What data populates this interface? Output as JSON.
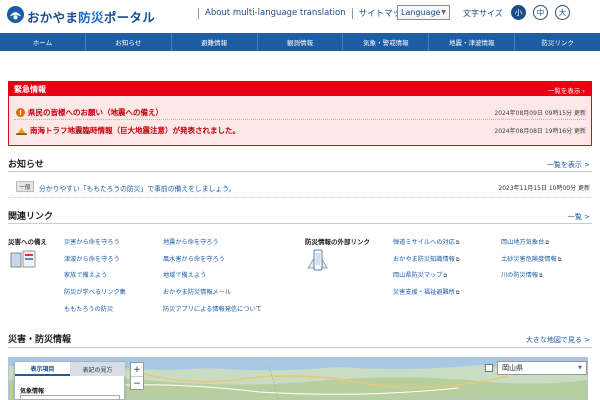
{
  "header": {
    "brand_prefix": "おかやま",
    "brand_highlight": "防災",
    "brand_suffix": "ポータル",
    "link_multilang": "About multi-language translation",
    "link_sitemap": "サイトマップ",
    "language_select": "Language",
    "font_size_label": "文字サイズ",
    "font_small": "小",
    "font_medium": "中",
    "font_large": "大"
  },
  "nav": [
    "ホーム",
    "お知らせ",
    "避難情報",
    "観測情報",
    "気象・警戒情報",
    "地震・津波情報",
    "防災リンク"
  ],
  "emergency": {
    "title": "緊急情報",
    "more": "一覧を表示 ›",
    "items": [
      {
        "text": "県民の皆様へのお願い（地震への備え）",
        "date": "2024年08月09日 09時15分 更新",
        "icon": "warning-icon"
      },
      {
        "text": "南海トラフ地震臨時情報（巨大地震注意）が発表されました。",
        "date": "2024年08月08日 19時16分 更新",
        "icon": "earthquake-icon"
      }
    ]
  },
  "notices": {
    "title": "お知らせ",
    "more": "一覧を表示 >",
    "items": [
      {
        "tag": "一般",
        "text": "分かりやすい「ももたろうの防災」で事前の備えをしましょう。",
        "date": "2023年11月15日 10時00分 更新"
      }
    ]
  },
  "links": {
    "title": "関連リンク",
    "more": "一覧 >",
    "block1_label": "災害への備え",
    "col1": [
      "災害から命を守ろう",
      "津波から命を守ろう",
      "家族で備えよう",
      "防災が学べるリンク集",
      "ももたろうの防災"
    ],
    "col2": [
      "地震から命を守ろう",
      "風水害から命を守ろう",
      "地域で備えよう",
      "おかやま防災情報メール",
      "防災アプリによる情報発信について"
    ],
    "block2_label": "防災情報の外部リンク",
    "col3": [
      "弾道ミサイルへの対応",
      "おかやま防災知識情報",
      "岡山県防災マップ",
      "災害支援・福祉避難所"
    ],
    "col4": [
      "岡山地方気象台",
      "土砂災害危険度情報",
      "川の防災情報"
    ]
  },
  "disaster": {
    "title": "災害・防災情報",
    "more": "大きな地図で見る >",
    "tab_display": "表示項目",
    "tab_legend": "表記の見方",
    "panel_label": "気象情報",
    "zoom_in": "+",
    "zoom_out": "−",
    "prefecture": "岡山県"
  },
  "colors": {
    "primary": "#1d5da3",
    "alert_red": "#e60012",
    "alert_bg": "#fde7e7"
  }
}
